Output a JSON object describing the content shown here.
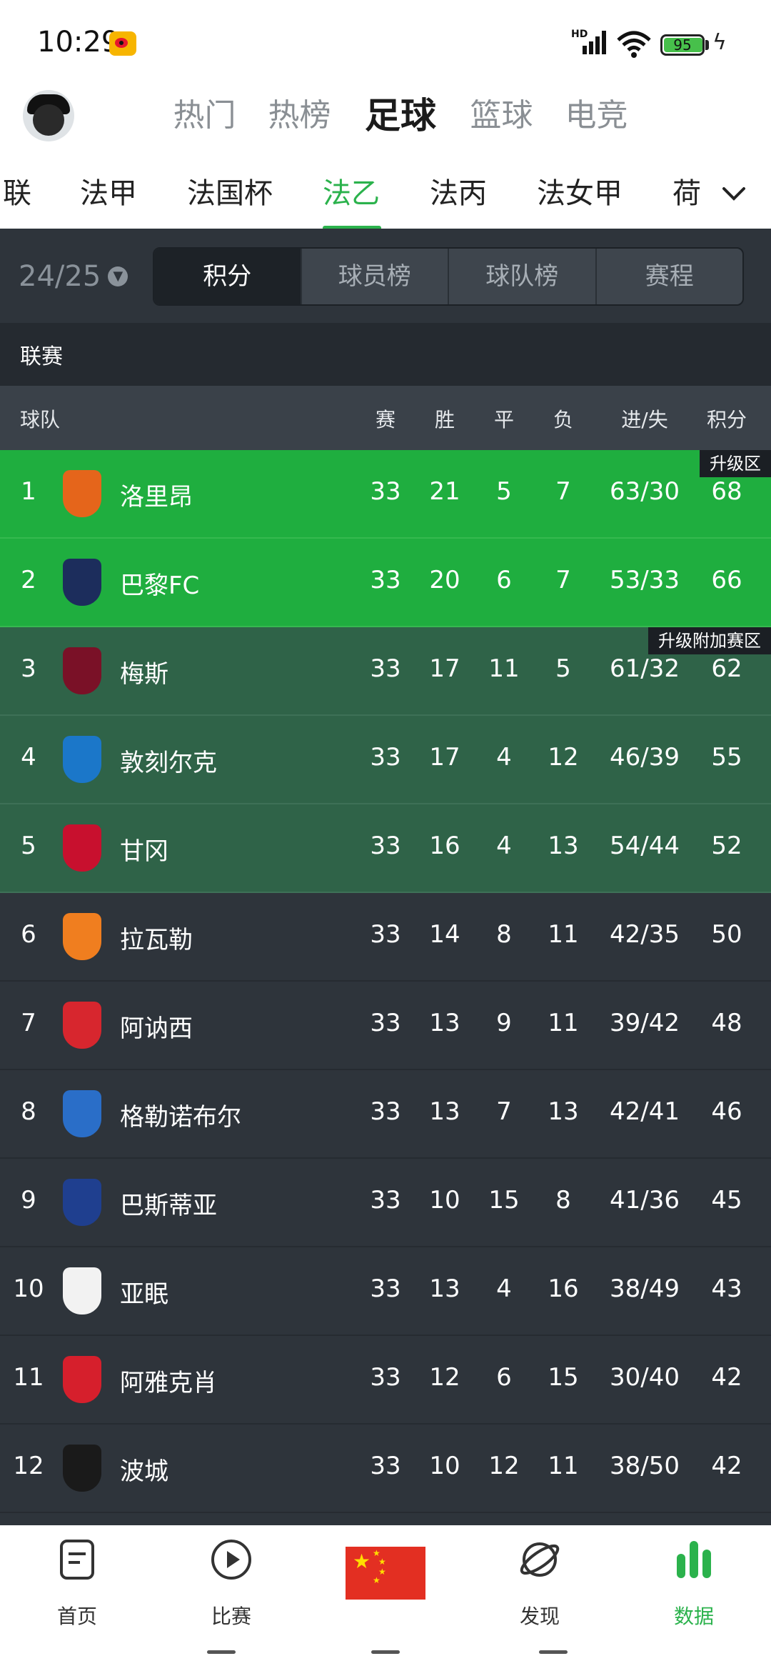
{
  "status_bar": {
    "time": "10:29",
    "network": "HD",
    "battery": "95"
  },
  "top_tabs": [
    {
      "label": "热门",
      "active": false
    },
    {
      "label": "热榜",
      "active": false
    },
    {
      "label": "足球",
      "active": true
    },
    {
      "label": "篮球",
      "active": false
    },
    {
      "label": "电竞",
      "active": false
    }
  ],
  "league_tabs": [
    {
      "label": "联",
      "active": false
    },
    {
      "label": "法甲",
      "active": false
    },
    {
      "label": "法国杯",
      "active": false
    },
    {
      "label": "法乙",
      "active": true
    },
    {
      "label": "法丙",
      "active": false
    },
    {
      "label": "法女甲",
      "active": false
    },
    {
      "label": "荷",
      "active": false
    }
  ],
  "season": "24/25",
  "segments": [
    {
      "label": "积分",
      "active": true
    },
    {
      "label": "球员榜",
      "active": false
    },
    {
      "label": "球队榜",
      "active": false
    },
    {
      "label": "赛程",
      "active": false
    }
  ],
  "section_title": "联赛",
  "columns": {
    "team": "球队",
    "played": "赛",
    "won": "胜",
    "drawn": "平",
    "lost": "负",
    "goals": "进/失",
    "points": "积分"
  },
  "zones": {
    "promotion": "升级区",
    "playoff": "升级附加赛区"
  },
  "standings": [
    {
      "rank": "1",
      "team": "洛里昂",
      "played": "33",
      "won": "21",
      "drawn": "5",
      "lost": "7",
      "goals": "63/30",
      "points": "68",
      "zone": "promotion",
      "badge_color": "#e5651b"
    },
    {
      "rank": "2",
      "team": "巴黎FC",
      "played": "33",
      "won": "20",
      "drawn": "6",
      "lost": "7",
      "goals": "53/33",
      "points": "66",
      "zone": "promotion",
      "badge_color": "#1c2d5c"
    },
    {
      "rank": "3",
      "team": "梅斯",
      "played": "33",
      "won": "17",
      "drawn": "11",
      "lost": "5",
      "goals": "61/32",
      "points": "62",
      "zone": "playoff",
      "badge_color": "#7a1127"
    },
    {
      "rank": "4",
      "team": "敦刻尔克",
      "played": "33",
      "won": "17",
      "drawn": "4",
      "lost": "12",
      "goals": "46/39",
      "points": "55",
      "zone": "playoff",
      "badge_color": "#1b77c9"
    },
    {
      "rank": "5",
      "team": "甘冈",
      "played": "33",
      "won": "16",
      "drawn": "4",
      "lost": "13",
      "goals": "54/44",
      "points": "52",
      "zone": "playoff",
      "badge_color": "#c8102e"
    },
    {
      "rank": "6",
      "team": "拉瓦勒",
      "played": "33",
      "won": "14",
      "drawn": "8",
      "lost": "11",
      "goals": "42/35",
      "points": "50",
      "zone": "none",
      "badge_color": "#f07e1f"
    },
    {
      "rank": "7",
      "team": "阿讷西",
      "played": "33",
      "won": "13",
      "drawn": "9",
      "lost": "11",
      "goals": "39/42",
      "points": "48",
      "zone": "none",
      "badge_color": "#d7262e"
    },
    {
      "rank": "8",
      "team": "格勒诺布尔",
      "played": "33",
      "won": "13",
      "drawn": "7",
      "lost": "13",
      "goals": "42/41",
      "points": "46",
      "zone": "none",
      "badge_color": "#2a6ec8"
    },
    {
      "rank": "9",
      "team": "巴斯蒂亚",
      "played": "33",
      "won": "10",
      "drawn": "15",
      "lost": "8",
      "goals": "41/36",
      "points": "45",
      "zone": "none",
      "badge_color": "#1f3f8f"
    },
    {
      "rank": "10",
      "team": "亚眠",
      "played": "33",
      "won": "13",
      "drawn": "4",
      "lost": "16",
      "goals": "38/49",
      "points": "43",
      "zone": "none",
      "badge_color": "#f2f2f2"
    },
    {
      "rank": "11",
      "team": "阿雅克肖",
      "played": "33",
      "won": "12",
      "drawn": "6",
      "lost": "15",
      "goals": "30/40",
      "points": "42",
      "zone": "none",
      "badge_color": "#d61f2c"
    },
    {
      "rank": "12",
      "team": "波城",
      "played": "33",
      "won": "10",
      "drawn": "12",
      "lost": "11",
      "goals": "38/50",
      "points": "42",
      "zone": "none",
      "badge_color": "#1a1a1a"
    }
  ],
  "bottom_nav": [
    {
      "label": "首页",
      "icon": "home-doc-icon",
      "active": false
    },
    {
      "label": "比赛",
      "icon": "play-circle-icon",
      "active": false
    },
    {
      "label": "",
      "icon": "china-flag-icon",
      "active": false
    },
    {
      "label": "发现",
      "icon": "planet-icon",
      "active": false
    },
    {
      "label": "数据",
      "icon": "bar-chart-icon",
      "active": true
    }
  ],
  "colors": {
    "accent": "#2bb24c",
    "promotion_row": "#1fae3f",
    "playoff_row": "#2f6348",
    "panel": "#2e343b"
  }
}
